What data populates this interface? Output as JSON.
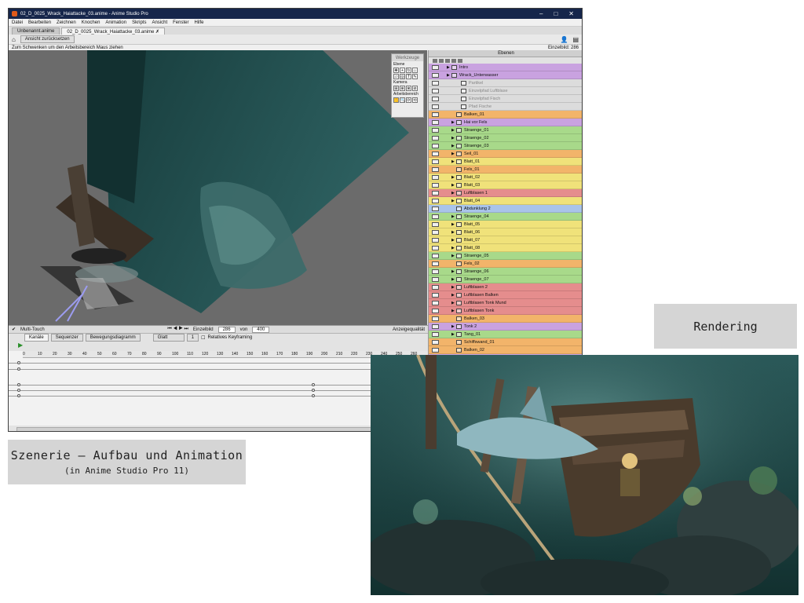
{
  "window": {
    "title": "02_D_0025_Wrack_Haiattacke_03.anime - Anime Studio Pro",
    "controls": [
      "–",
      "□",
      "✕"
    ]
  },
  "menu": [
    "Datei",
    "Bearbeiten",
    "Zeichnen",
    "Knochen",
    "Animation",
    "Skripts",
    "Ansicht",
    "Fenster",
    "Hilfe"
  ],
  "tabs": [
    {
      "label": "Unbenannt.anime"
    },
    {
      "label": "02_D_0025_Wrack_Haiattacke_03.anime ✗"
    }
  ],
  "toolbar": {
    "reset_view": "Ansicht zurücksetzen",
    "hint": "Zum Schwenken um den Arbeitsbereich Maus ziehen",
    "frame_label": "Einzelbild: 286"
  },
  "tools_panel": {
    "title": "Werkzeuge",
    "sections": [
      "Ebene",
      "Kamera",
      "Arbeitsbereich"
    ]
  },
  "layers_panel": {
    "title": "Ebenen",
    "items": [
      {
        "name": "Intro",
        "color": "#c9a2e0",
        "indent": 1,
        "kind": "folder"
      },
      {
        "name": "Wrack_Unterwasser",
        "color": "#c9a2e0",
        "indent": 1,
        "kind": "folder"
      },
      {
        "name": "Partikel",
        "color": "#dcdcdc",
        "indent": 3,
        "kind": "dim"
      },
      {
        "name": "Einzelpfad Luftblase",
        "color": "#dcdcdc",
        "indent": 3,
        "kind": "dim"
      },
      {
        "name": "Einzelpfad Fisch",
        "color": "#dcdcdc",
        "indent": 3,
        "kind": "dim"
      },
      {
        "name": "Pfad Fische",
        "color": "#dcdcdc",
        "indent": 3,
        "kind": "dim"
      },
      {
        "name": "Balken_01",
        "color": "#f2b46a",
        "indent": 2,
        "kind": "image"
      },
      {
        "name": "Hai vor Fels",
        "color": "#c9a2e0",
        "indent": 2,
        "kind": "group"
      },
      {
        "name": "Straenge_01",
        "color": "#a8d98a",
        "indent": 2,
        "kind": "group"
      },
      {
        "name": "Straenge_02",
        "color": "#a8d98a",
        "indent": 2,
        "kind": "group"
      },
      {
        "name": "Straenge_03",
        "color": "#a8d98a",
        "indent": 2,
        "kind": "group"
      },
      {
        "name": "Seil_01",
        "color": "#f2b46a",
        "indent": 2,
        "kind": "group"
      },
      {
        "name": "Blatt_01",
        "color": "#f0e27a",
        "indent": 2,
        "kind": "group"
      },
      {
        "name": "Fels_01",
        "color": "#f2b46a",
        "indent": 2,
        "kind": "image"
      },
      {
        "name": "Blatt_02",
        "color": "#f0e27a",
        "indent": 2,
        "kind": "group"
      },
      {
        "name": "Blatt_03",
        "color": "#f0e27a",
        "indent": 2,
        "kind": "group"
      },
      {
        "name": "Luftblasen 1",
        "color": "#e58d8d",
        "indent": 2,
        "kind": "group"
      },
      {
        "name": "Blatt_04",
        "color": "#f0e27a",
        "indent": 2,
        "kind": "group"
      },
      {
        "name": "Abdunklung 2",
        "color": "#a9c4ea",
        "indent": 2,
        "kind": "image"
      },
      {
        "name": "Straenge_04",
        "color": "#a8d98a",
        "indent": 2,
        "kind": "group"
      },
      {
        "name": "Blatt_05",
        "color": "#f0e27a",
        "indent": 2,
        "kind": "group"
      },
      {
        "name": "Blatt_06",
        "color": "#f0e27a",
        "indent": 2,
        "kind": "group"
      },
      {
        "name": "Blatt_07",
        "color": "#f0e27a",
        "indent": 2,
        "kind": "group"
      },
      {
        "name": "Blatt_08",
        "color": "#f0e27a",
        "indent": 2,
        "kind": "group"
      },
      {
        "name": "Straenge_05",
        "color": "#a8d98a",
        "indent": 2,
        "kind": "group"
      },
      {
        "name": "Fels_02",
        "color": "#f2b46a",
        "indent": 2,
        "kind": "image"
      },
      {
        "name": "Straenge_06",
        "color": "#a8d98a",
        "indent": 2,
        "kind": "group"
      },
      {
        "name": "Straenge_07",
        "color": "#a8d98a",
        "indent": 2,
        "kind": "group"
      },
      {
        "name": "Luftblasen 2",
        "color": "#e58d8d",
        "indent": 2,
        "kind": "group"
      },
      {
        "name": "Luftblasen Balken",
        "color": "#e58d8d",
        "indent": 2,
        "kind": "group"
      },
      {
        "name": "Luftblasen Tonk Mund",
        "color": "#e58d8d",
        "indent": 2,
        "kind": "group"
      },
      {
        "name": "Luftblasen Tonk",
        "color": "#e58d8d",
        "indent": 2,
        "kind": "group"
      },
      {
        "name": "Balken_03",
        "color": "#f2b46a",
        "indent": 2,
        "kind": "image"
      },
      {
        "name": "Tonk 2",
        "color": "#c9a2e0",
        "indent": 2,
        "kind": "group"
      },
      {
        "name": "Tang_01",
        "color": "#a8d98a",
        "indent": 2,
        "kind": "group"
      },
      {
        "name": "Schiffswand_01",
        "color": "#f2b46a",
        "indent": 2,
        "kind": "image"
      },
      {
        "name": "Balken_02",
        "color": "#f2b46a",
        "indent": 2,
        "kind": "image"
      },
      {
        "name": "Tonk",
        "color": "#c9a2e0",
        "indent": 2,
        "kind": "group"
      },
      {
        "name": "Schiffswand_02",
        "color": "#f2b46a",
        "indent": 2,
        "kind": "image"
      },
      {
        "name": "Luftblasen 3",
        "color": "#e58d8d",
        "indent": 2,
        "kind": "group"
      }
    ]
  },
  "canvas_footer": {
    "multitouch": "Multi-Touch",
    "frame_label": "Einzelbild",
    "frame_value": "286",
    "of_label": "von",
    "of_value": "400",
    "quality": "Anzeigequalität"
  },
  "timeline": {
    "tabs": [
      "Kanäle",
      "Sequenzer",
      "Bewegungsdiagramm"
    ],
    "smooth": "Glatt",
    "step": "1",
    "relative_keyframing": "Relatives Keyframing",
    "ticks": [
      "0",
      "10",
      "20",
      "30",
      "40",
      "50",
      "60",
      "70",
      "80",
      "90",
      "100",
      "110",
      "120",
      "130",
      "140",
      "150",
      "160",
      "170",
      "180",
      "190",
      "200",
      "210",
      "220",
      "230",
      "240",
      "250",
      "260"
    ]
  },
  "captions": {
    "scene_title": "Szenerie – Aufbau und Animation",
    "scene_sub": "(in Anime Studio Pro 11)",
    "render": "Rendering"
  },
  "colors": {
    "titlebar": "#16264b",
    "selected_layer": "#a9c4ea",
    "canvas_bg": "#6b6b6b",
    "water": "#2d5a5a"
  }
}
